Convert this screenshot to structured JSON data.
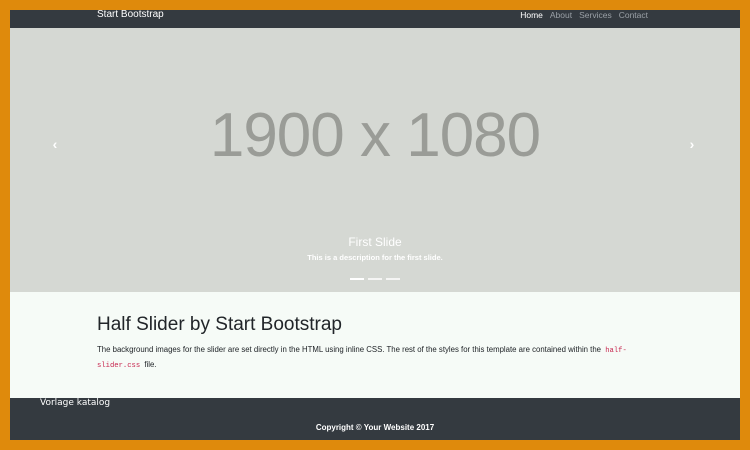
{
  "navbar": {
    "brand": "Start Bootstrap",
    "links": [
      "Home",
      "About",
      "Services",
      "Contact"
    ]
  },
  "slider": {
    "placeholder_text": "1900 x 1080",
    "prev_icon": "chevron-left-icon",
    "next_icon": "chevron-right-icon",
    "caption_title": "First Slide",
    "caption_description": "This is a description for the first slide.",
    "slide_count": 3,
    "active_slide": 1
  },
  "content": {
    "heading": "Half Slider by Start Bootstrap",
    "paragraph_start": "The background images for the slider are set directly in the HTML using inline CSS. The rest of the styles for this template are contained within the",
    "code_text": "half-slider.css",
    "paragraph_end": "file."
  },
  "watermark": "Vorlage katalog",
  "footer": {
    "copyright": "Copyright © Your Website 2017"
  },
  "colors": {
    "border": "#df8a0c",
    "navbar_bg": "#343a40",
    "slider_bg": "#d5d8d3",
    "content_bg": "#f6fbf7",
    "code": "#c7254e"
  }
}
